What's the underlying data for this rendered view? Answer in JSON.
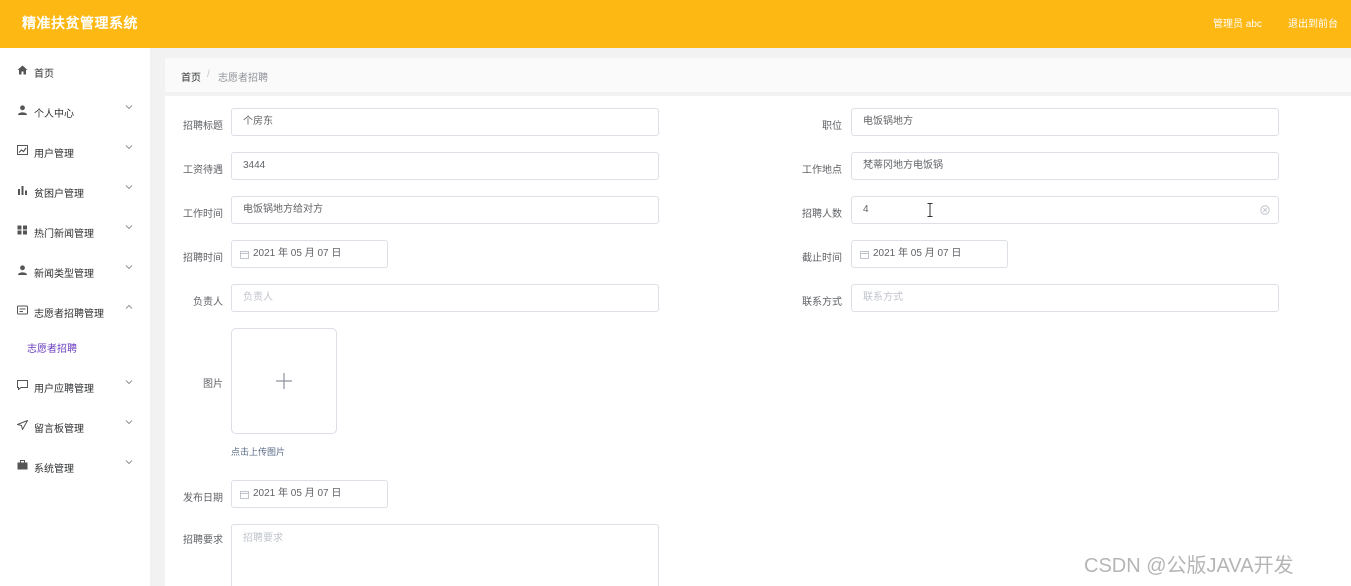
{
  "header": {
    "title": "精准扶贫管理系统",
    "admin_label": "管理员 abc",
    "exit_label": "退出到前台",
    "background": "#fdb813"
  },
  "sidebar": {
    "items": [
      {
        "label": "首页",
        "icon": "home-icon",
        "expandable": false
      },
      {
        "label": "个人中心",
        "icon": "user-icon",
        "expandable": true
      },
      {
        "label": "用户管理",
        "icon": "chart-icon",
        "expandable": true
      },
      {
        "label": "贫困户管理",
        "icon": "bar-chart-icon",
        "expandable": true
      },
      {
        "label": "热门新闻管理",
        "icon": "grid-icon",
        "expandable": true
      },
      {
        "label": "新闻类型管理",
        "icon": "user-icon",
        "expandable": true
      },
      {
        "label": "志愿者招聘管理",
        "icon": "card-icon",
        "expandable": true,
        "expanded": true
      },
      {
        "label": "用户应聘管理",
        "icon": "message-icon",
        "expandable": true
      },
      {
        "label": "留言板管理",
        "icon": "send-icon",
        "expandable": true
      },
      {
        "label": "系统管理",
        "icon": "briefcase-icon",
        "expandable": true
      }
    ],
    "sub_item": "志愿者招聘",
    "accent": "#6a3dbe"
  },
  "breadcrumb": {
    "home": "首页",
    "separator": "/",
    "current": "志愿者招聘"
  },
  "form": {
    "title_label": "招聘标题",
    "title_value": "个房东",
    "position_label": "职位",
    "position_value": "电饭锅地方",
    "salary_label": "工资待遇",
    "salary_value": "3444",
    "location_label": "工作地点",
    "location_value": "梵蒂冈地方电饭锅",
    "worktime_label": "工作时间",
    "worktime_value": "电饭锅地方给对方",
    "headcount_label": "招聘人数",
    "headcount_value": "4",
    "recruit_time_label": "招聘时间",
    "recruit_time_value": "2021 年 05 月 07 日",
    "deadline_label": "截止时间",
    "deadline_value": "2021 年 05 月 07 日",
    "owner_label": "负责人",
    "owner_placeholder": "负责人",
    "contact_label": "联系方式",
    "contact_placeholder": "联系方式",
    "image_label": "图片",
    "upload_hint": "点击上传图片",
    "publish_date_label": "发布日期",
    "publish_date_value": "2021 年 05 月 07 日",
    "requirements_label": "招聘要求",
    "requirements_placeholder": "招聘要求"
  },
  "watermark": "CSDN @公版JAVA开发"
}
